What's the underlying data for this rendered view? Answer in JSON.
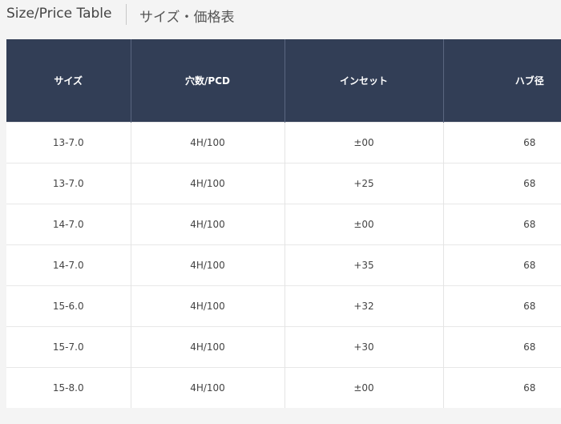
{
  "header": {
    "title_en": "Size/Price Table",
    "title_ja": "サイズ・価格表"
  },
  "table": {
    "columns": [
      "サイズ",
      "穴数/PCD",
      "インセット",
      "ハブ径"
    ],
    "rows": [
      [
        "13-7.0",
        "4H/100",
        "±00",
        "68"
      ],
      [
        "13-7.0",
        "4H/100",
        "+25",
        "68"
      ],
      [
        "14-7.0",
        "4H/100",
        "±00",
        "68"
      ],
      [
        "14-7.0",
        "4H/100",
        "+35",
        "68"
      ],
      [
        "15-6.0",
        "4H/100",
        "+32",
        "68"
      ],
      [
        "15-7.0",
        "4H/100",
        "+30",
        "68"
      ],
      [
        "15-8.0",
        "4H/100",
        "±00",
        "68"
      ]
    ]
  },
  "colors": {
    "header_bg": "#323e56",
    "header_text": "#ffffff",
    "row_bg": "#ffffff",
    "page_bg": "#f4f4f4"
  }
}
